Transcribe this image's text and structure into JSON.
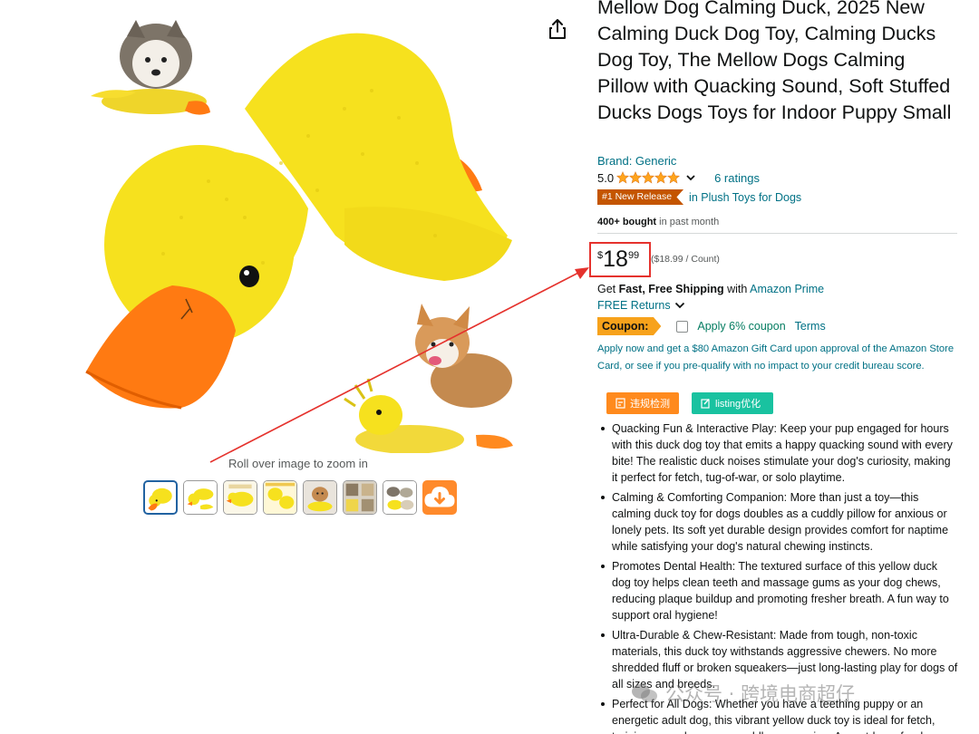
{
  "product": {
    "title": "Mellow Dog Calming Duck, 2025 New Calming Duck Dog Toy, Calming Ducks Dog Toy, The Mellow Dogs Calming Pillow with Quacking Sound, Soft Stuffed Ducks Dogs Toys for Indoor Puppy Small",
    "brand": "Brand: Generic",
    "rating_value": "5.0",
    "rating_stars": 5,
    "ratings_count": "6 ratings",
    "badge": "#1 New Release",
    "badge_category": "in Plush Toys for Dogs",
    "bought_bold": "400+ bought",
    "bought_rest": " in past month"
  },
  "price": {
    "currency": "$",
    "whole": "18",
    "fraction": "99",
    "unit_price": "($18.99 / Count)"
  },
  "shipping": {
    "get": "Get ",
    "bold": "Fast, Free Shipping",
    "with": " with ",
    "prime": "Amazon Prime",
    "returns": "FREE Returns"
  },
  "coupon": {
    "tag": "Coupon:",
    "apply": "Apply 6% coupon",
    "terms": "Terms"
  },
  "giftcard_text": "Apply now and get a $80 Amazon Gift Card upon approval of the Amazon Store Card, or see if you pre-qualify with no impact to your credit bureau score.",
  "extension_buttons": {
    "violation": "违规检测",
    "listing": "listing优化"
  },
  "bullets": [
    "Quacking Fun & Interactive Play: Keep your pup engaged for hours with this duck dog toy that emits a happy quacking sound with every bite! The realistic duck noises stimulate your dog's curiosity, making it perfect for fetch, tug-of-war, or solo playtime.",
    "Calming & Comforting Companion: More than just a toy—this calming duck toy for dogs doubles as a cuddly pillow for anxious or lonely pets. Its soft yet durable design provides comfort for naptime while satisfying your dog's natural chewing instincts.",
    "Promotes Dental Health: The textured surface of this yellow duck dog toy helps clean teeth and massage gums as your dog chews, reducing plaque buildup and promoting fresher breath. A fun way to support oral hygiene!",
    "Ultra-Durable & Chew-Resistant: Made from tough, non-toxic materials, this duck toy withstands aggressive chewers. No more shredded fluff or broken squeakers—just long-lasting play for dogs of all sizes and breeds.",
    "Perfect for All Dogs: Whether you have a teething puppy or an energetic adult dog, this vibrant yellow duck toy is ideal for fetch, training rewards, or as a cuddle companion. A must-have for dog lovers!"
  ],
  "media": {
    "zoom_hint": "Roll over image to zoom in",
    "thumbnail_count": 7,
    "selected_thumbnail": 1
  },
  "watermark": "公众号 · 跨境电商超仔",
  "colors": {
    "link": "#007185",
    "badge": "#C45500",
    "coupon": "#F7A21B",
    "coupon_apply": "#067D62",
    "star": "#FFA41C",
    "highlight_box": "#e5322d",
    "ext_orange": "#ff8a1d",
    "ext_teal": "#19c2a0",
    "duck_yellow": "#F6E11E",
    "duck_orange": "#FF7A12"
  }
}
